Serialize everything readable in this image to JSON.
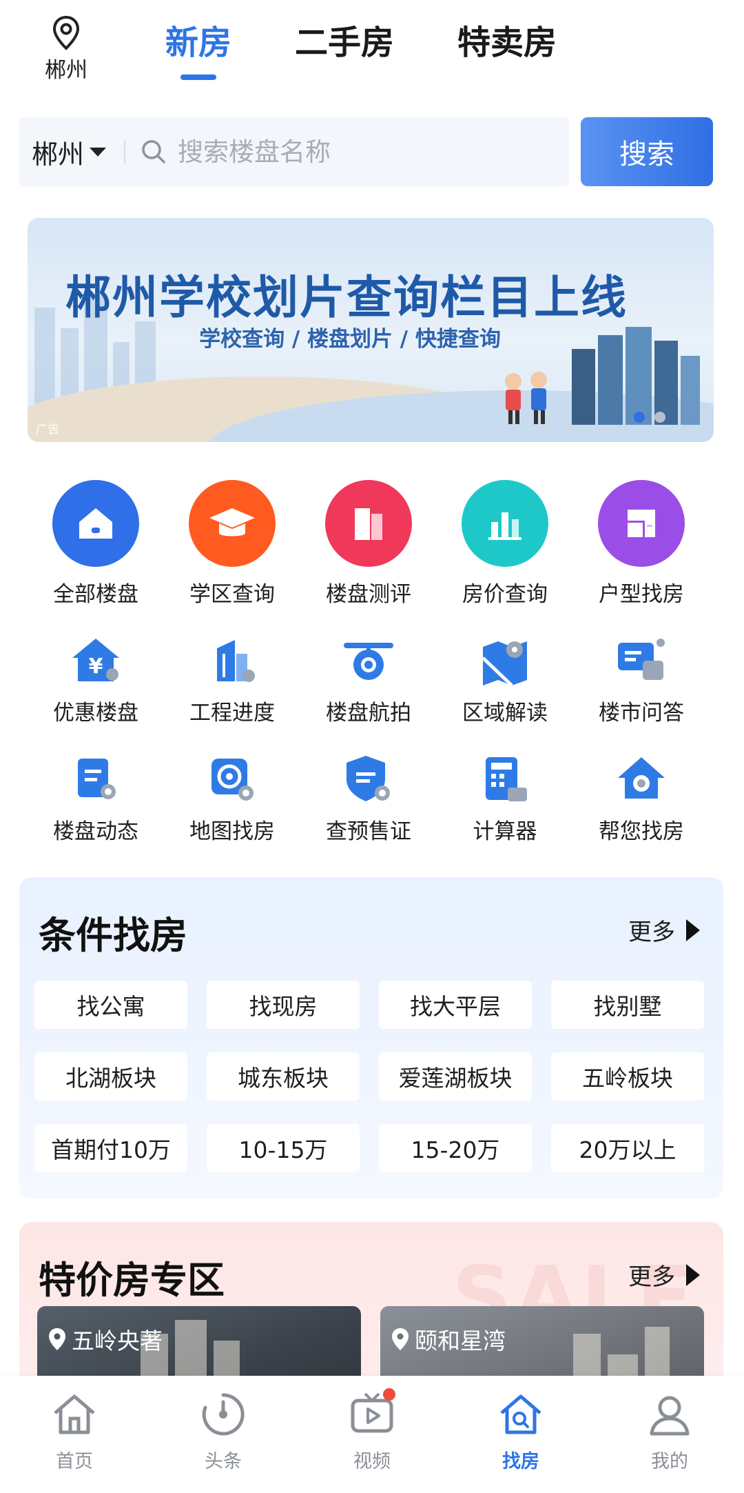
{
  "header": {
    "location": "郴州",
    "tabs": [
      {
        "label": "新房",
        "active": true
      },
      {
        "label": "二手房",
        "active": false
      },
      {
        "label": "特卖房",
        "active": false
      }
    ]
  },
  "search": {
    "city": "郴州",
    "placeholder": "搜索楼盘名称",
    "button_label": "搜索"
  },
  "banner": {
    "title": "郴州学校划片查询栏目上线",
    "subtitle": "学校查询 / 楼盘划片 / 快捷查询",
    "ad_label": "广告",
    "pages": 2,
    "current_page": 1
  },
  "main_entries": [
    {
      "label": "全部楼盘",
      "icon": "house-icon",
      "color": "#2f6fe8"
    },
    {
      "label": "学区查询",
      "icon": "graduation-cap-icon",
      "color": "#ff5a1f"
    },
    {
      "label": "楼盘测评",
      "icon": "building-rating-icon",
      "color": "#f0385a"
    },
    {
      "label": "房价查询",
      "icon": "bar-chart-icon",
      "color": "#1fc8c8"
    },
    {
      "label": "户型找房",
      "icon": "floor-plan-icon",
      "color": "#9b4de8"
    }
  ],
  "tools_row1": [
    {
      "label": "优惠楼盘",
      "icon": "discount-house-icon"
    },
    {
      "label": "工程进度",
      "icon": "construction-progress-icon"
    },
    {
      "label": "楼盘航拍",
      "icon": "drone-icon"
    },
    {
      "label": "区域解读",
      "icon": "map-location-icon"
    },
    {
      "label": "楼市问答",
      "icon": "chat-icon"
    }
  ],
  "tools_row2": [
    {
      "label": "楼盘动态",
      "icon": "news-search-icon"
    },
    {
      "label": "地图找房",
      "icon": "map-target-icon"
    },
    {
      "label": "查预售证",
      "icon": "certificate-shield-icon"
    },
    {
      "label": "计算器",
      "icon": "calculator-icon"
    },
    {
      "label": "帮您找房",
      "icon": "house-search-icon"
    }
  ],
  "condition_search": {
    "title": "条件找房",
    "more": "更多",
    "rows": [
      [
        "找公寓",
        "找现房",
        "找大平层",
        "找别墅"
      ],
      [
        "北湖板块",
        "城东板块",
        "爱莲湖板块",
        "五岭板块"
      ],
      [
        "首期付10万",
        "10-15万",
        "15-20万",
        "20万以上"
      ]
    ]
  },
  "discount_zone": {
    "title": "特价房专区",
    "more": "更多",
    "watermark": "SALE",
    "properties": [
      {
        "name": "五岭央著"
      },
      {
        "name": "颐和星湾"
      }
    ]
  },
  "bottom_nav": [
    {
      "label": "首页",
      "icon": "home-icon",
      "active": false
    },
    {
      "label": "头条",
      "icon": "headline-icon",
      "active": false
    },
    {
      "label": "视频",
      "icon": "video-icon",
      "active": false,
      "badge": true
    },
    {
      "label": "找房",
      "icon": "find-house-icon",
      "active": true
    },
    {
      "label": "我的",
      "icon": "profile-icon",
      "active": false
    }
  ],
  "colors": {
    "accent": "#2e74e6",
    "condition_bg": "#e9f1ff",
    "discount_bg": "#fde6e6",
    "badge": "#f04a3a"
  }
}
